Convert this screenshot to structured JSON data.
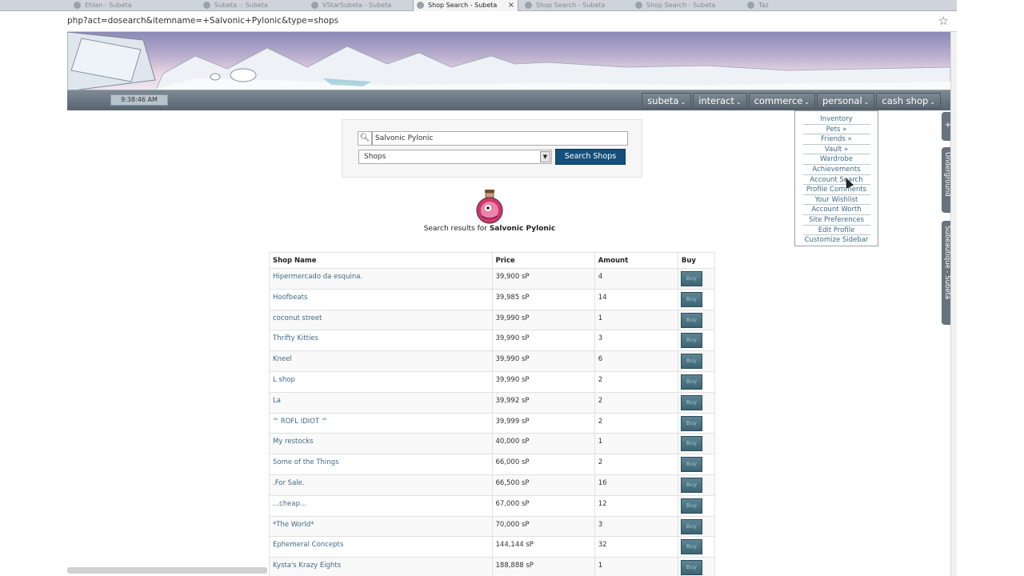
{
  "browser": {
    "tabs": [
      {
        "label": "Ehlan - Subeta",
        "active": false
      },
      {
        "label": "Subeta :: Subeta",
        "active": false
      },
      {
        "label": "VStarSubeta - Subeta",
        "active": false
      },
      {
        "label": "Shop Search - Subeta",
        "active": true
      },
      {
        "label": "Shop Search - Subeta",
        "active": false
      },
      {
        "label": "Shop Search - Subeta",
        "active": false
      },
      {
        "label": "Taz",
        "active": false
      }
    ],
    "url": "php?act=dosearch&itemname=+Salvonic+Pylonic&type=shops"
  },
  "header": {
    "clock": "9:38:46 AM",
    "nav": [
      "subeta",
      "interact",
      "commerce",
      "personal",
      "cash shop"
    ]
  },
  "side_tabs": {
    "plus": "+",
    "underground": "Underground",
    "subeautique": "Subeautique - Subeta"
  },
  "personal_menu": [
    "Inventory",
    "Pets »",
    "Friends »",
    "Vault »",
    "Wardrobe",
    "Achievements",
    "Account Search",
    "Profile Comments",
    "Your Wishlist",
    "Account Worth",
    "Site Preferences",
    "Edit Profile",
    "Customize Sidebar"
  ],
  "search": {
    "query": "Salvonic Pylonic",
    "type": "Shops",
    "button": "Search Shops"
  },
  "results": {
    "prefix": "Search results for",
    "item": "Salvonic Pylonic"
  },
  "table": {
    "headers": [
      "Shop Name",
      "Price",
      "Amount",
      "Buy"
    ],
    "buy_label": "Buy",
    "rows": [
      {
        "shop": "Hipermercado da esquina.",
        "price": "39,900 sP",
        "amount": "4"
      },
      {
        "shop": "Hoofbeats",
        "price": "39,985 sP",
        "amount": "14"
      },
      {
        "shop": "coconut street",
        "price": "39,990 sP",
        "amount": "1"
      },
      {
        "shop": "Thrifty Kitties",
        "price": "39,990 sP",
        "amount": "3"
      },
      {
        "shop": "Kneel",
        "price": "39,990 sP",
        "amount": "6"
      },
      {
        "shop": "L shop",
        "price": "39,990 sP",
        "amount": "2"
      },
      {
        "shop": "La",
        "price": "39,992 sP",
        "amount": "2"
      },
      {
        "shop": "^ ROFL IDIOT ^",
        "price": "39,999 sP",
        "amount": "2"
      },
      {
        "shop": "My restocks",
        "price": "40,000 sP",
        "amount": "1"
      },
      {
        "shop": "Some of the Things",
        "price": "66,000 sP",
        "amount": "2"
      },
      {
        "shop": ".For Sale.",
        "price": "66,500 sP",
        "amount": "16"
      },
      {
        "shop": "...cheap...",
        "price": "67,000 sP",
        "amount": "12"
      },
      {
        "shop": "*The World*",
        "price": "70,000 sP",
        "amount": "3"
      },
      {
        "shop": "Ephemeral Concepts",
        "price": "144,144 sP",
        "amount": "32"
      },
      {
        "shop": "Kysta's Krazy Eights",
        "price": "188,888 sP",
        "amount": "1"
      }
    ]
  },
  "colors": {
    "nav_bg": "#5c6872",
    "search_button": "#154f7a",
    "link": "#3f6b88",
    "buy_button": "#4a7280"
  }
}
